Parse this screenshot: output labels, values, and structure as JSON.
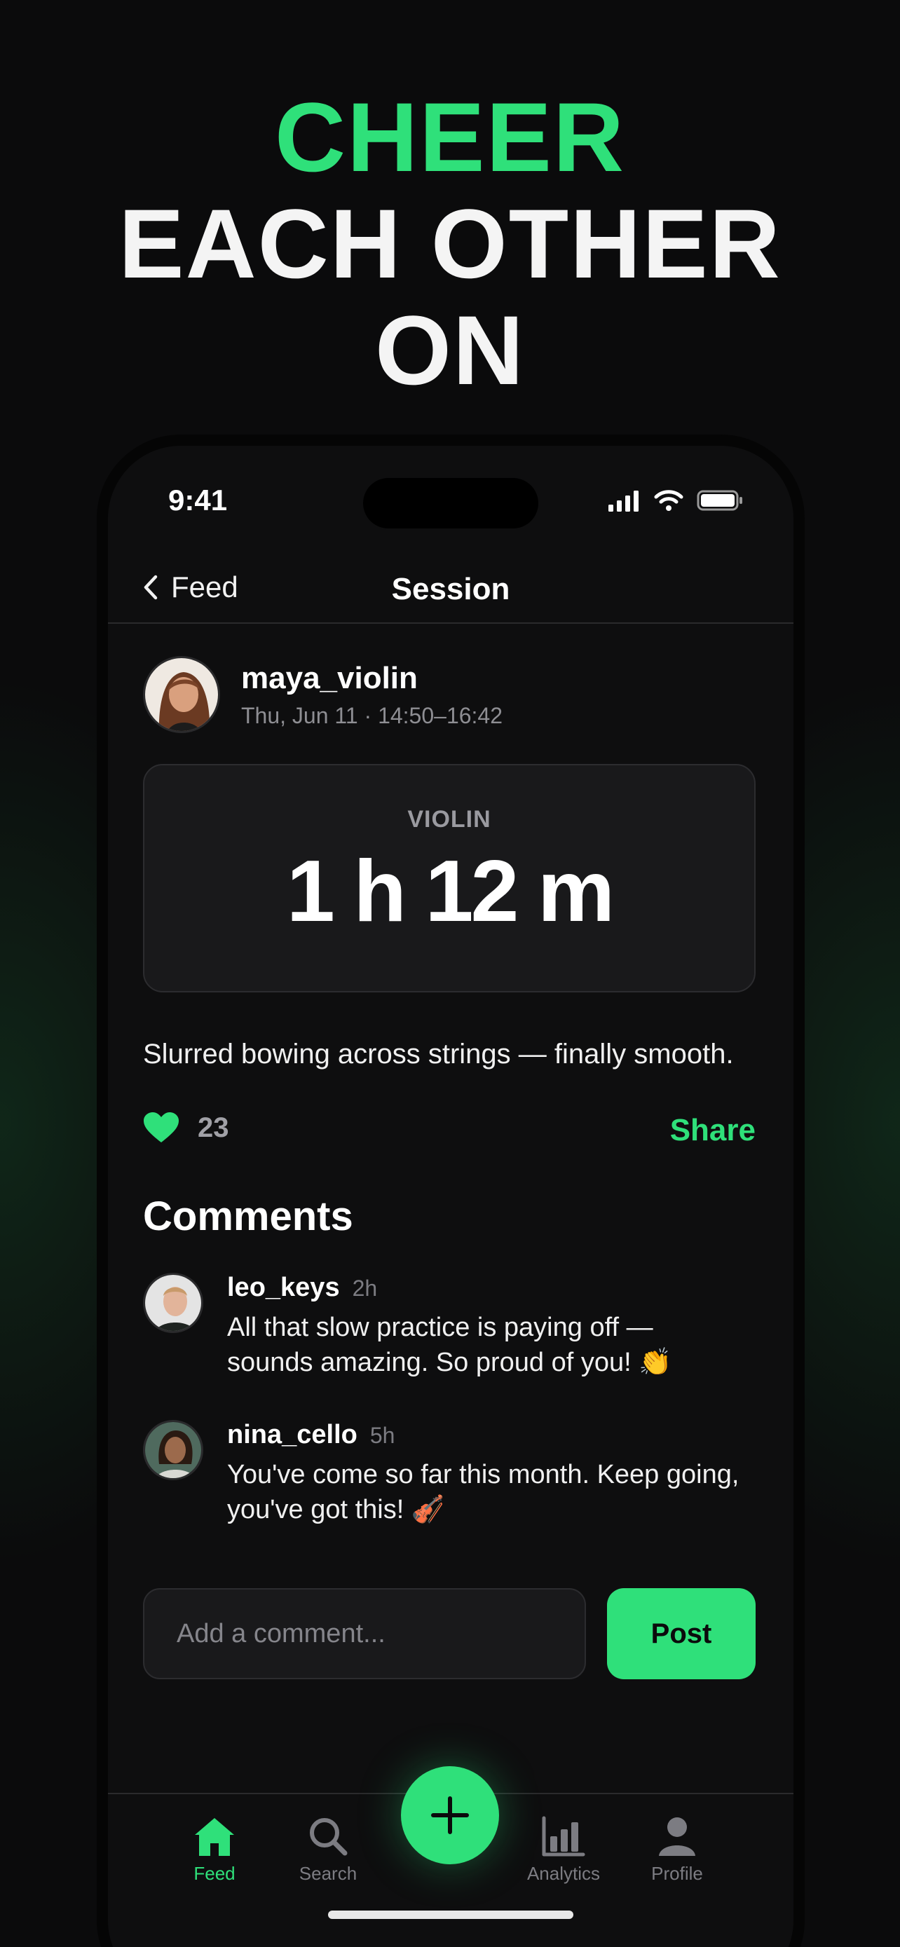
{
  "headline": {
    "line1": "CHEER",
    "line2": "EACH OTHER",
    "line3": "ON"
  },
  "status_bar": {
    "time": "9:41"
  },
  "nav": {
    "back_label": "Feed",
    "title": "Session"
  },
  "post": {
    "username": "maya_violin",
    "timestamp": "Thu, Jun 11 · 14:50–16:42",
    "instrument": "VIOLIN",
    "duration": "1 h 12 m",
    "caption": "Slurred bowing across strings — finally smooth.",
    "likes": "23",
    "share_label": "Share"
  },
  "comments": {
    "title": "Comments",
    "items": [
      {
        "user": "leo_keys",
        "age": "2h",
        "text": "All that slow practice is paying off — sounds amazing. So proud of you! 👏"
      },
      {
        "user": "nina_cello",
        "age": "5h",
        "text": "You've come so far this month. Keep going, you've got this! 🎻"
      }
    ]
  },
  "composer": {
    "placeholder": "Add a comment...",
    "post_label": "Post"
  },
  "tabs": [
    {
      "label": "Feed",
      "icon": "home-icon"
    },
    {
      "label": "Search",
      "icon": "search-icon"
    },
    {
      "label": "Analytics",
      "icon": "bar-chart-icon"
    },
    {
      "label": "Profile",
      "icon": "person-icon"
    }
  ],
  "colors": {
    "accent": "#2fe07a",
    "background": "#0b0b0c",
    "card": "#19191b"
  }
}
